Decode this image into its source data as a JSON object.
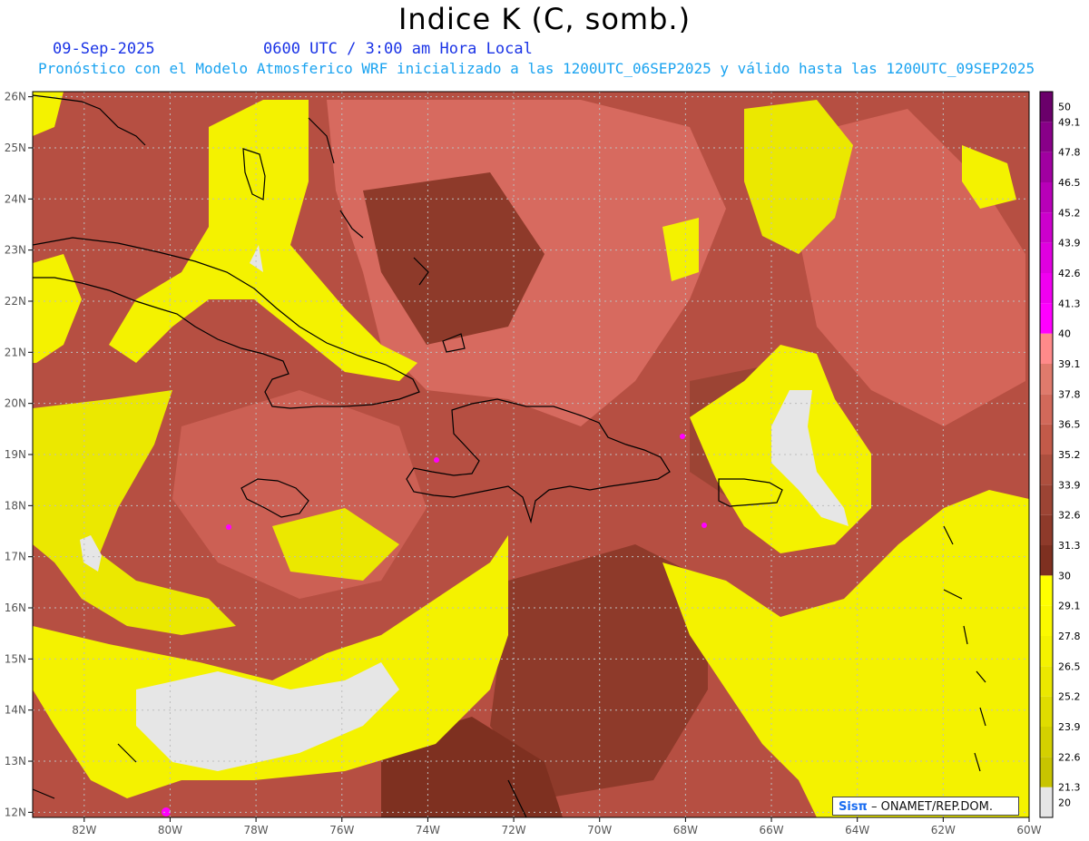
{
  "header": {
    "title": "Indice K (C, somb.)",
    "date": "09-Sep-2025",
    "time": "0600 UTC / 3:00 am Hora Local",
    "subtitle": "Pronóstico con el Modelo Atmosferico WRF inicializado a las 1200UTC_06SEP2025 y válido hasta las  1200UTC_09SEP2025"
  },
  "map": {
    "lon_ticks": [
      "82W",
      "80W",
      "78W",
      "76W",
      "74W",
      "72W",
      "70W",
      "68W",
      "66W",
      "64W",
      "62W",
      "60W"
    ],
    "lat_ticks": [
      "12N",
      "13N",
      "14N",
      "15N",
      "16N",
      "17N",
      "18N",
      "19N",
      "20N",
      "21N",
      "22N",
      "23N",
      "24N",
      "25N",
      "26N"
    ],
    "lon_range": [
      -83.2,
      -60
    ],
    "lat_range": [
      11.9,
      26.1
    ],
    "colors": {
      "coast": "#000000",
      "grid": "#bdbdbd"
    }
  },
  "legend": {
    "labels": [
      "20",
      "21.3",
      "22.6",
      "23.9",
      "25.2",
      "26.5",
      "27.8",
      "29.1",
      "30",
      "31.3",
      "32.6",
      "33.9",
      "35.2",
      "36.5",
      "37.8",
      "39.1",
      "40",
      "41.3",
      "42.6",
      "43.9",
      "45.2",
      "46.5",
      "47.8",
      "49.1",
      "50"
    ],
    "colors": [
      "#e6e6e6",
      "#c8c400",
      "#d4d000",
      "#e0dc00",
      "#ebe800",
      "#f4f200",
      "#fbf900",
      "#ffff00",
      "#7e3020",
      "#8e3a2a",
      "#9c4434",
      "#ad4f3e",
      "#c25a49",
      "#d2695a",
      "#e07a6c",
      "#ff8a8a",
      "#ff00ff",
      "#f000f0",
      "#e000e0",
      "#cc00cc",
      "#b800b8",
      "#a000a0",
      "#880088",
      "#6a006a"
    ]
  },
  "credit": {
    "brand": "Sisπ",
    "text": "– ONAMET/REP.DOM."
  }
}
